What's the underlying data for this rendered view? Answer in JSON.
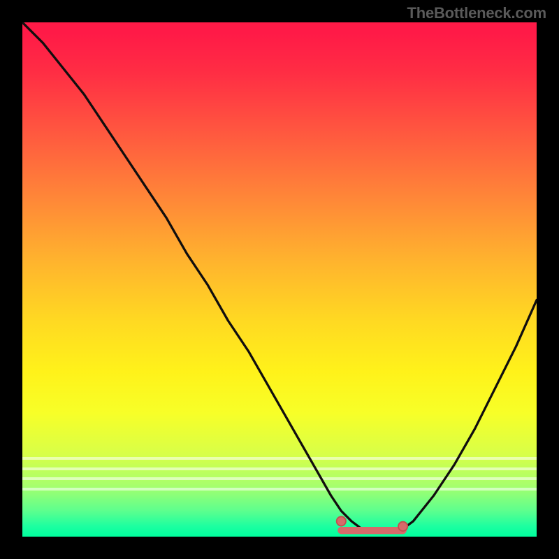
{
  "watermark": "TheBottleneck.com",
  "colors": {
    "frame": "#000000",
    "curve": "#110e0e",
    "marker_fill": "#d66a6a",
    "marker_stroke": "#c24f4f"
  },
  "chart_data": {
    "type": "line",
    "title": "",
    "xlabel": "",
    "ylabel": "",
    "xlim": [
      0,
      100
    ],
    "ylim": [
      0,
      100
    ],
    "grid": false,
    "legend": false,
    "series": [
      {
        "name": "bottleneck-curve",
        "x": [
          0,
          4,
          8,
          12,
          16,
          20,
          24,
          28,
          32,
          36,
          40,
          44,
          48,
          52,
          56,
          60,
          62,
          64,
          66,
          68,
          70,
          72,
          74,
          76,
          80,
          84,
          88,
          92,
          96,
          100
        ],
        "y": [
          100,
          96,
          91,
          86,
          80,
          74,
          68,
          62,
          55,
          49,
          42,
          36,
          29,
          22,
          15,
          8,
          5,
          3,
          1.5,
          1,
          1,
          1,
          1.5,
          3,
          8,
          14,
          21,
          29,
          37,
          46
        ]
      }
    ],
    "markers": [
      {
        "name": "flat-segment-left",
        "x": 62,
        "y": 3.0
      },
      {
        "name": "flat-segment-right",
        "x": 74,
        "y": 2.0
      }
    ],
    "flat_segment": {
      "x0": 62,
      "x1": 74,
      "y": 1.2
    },
    "white_bands_y": [
      84.5,
      86.5,
      88.5,
      90.5
    ]
  }
}
